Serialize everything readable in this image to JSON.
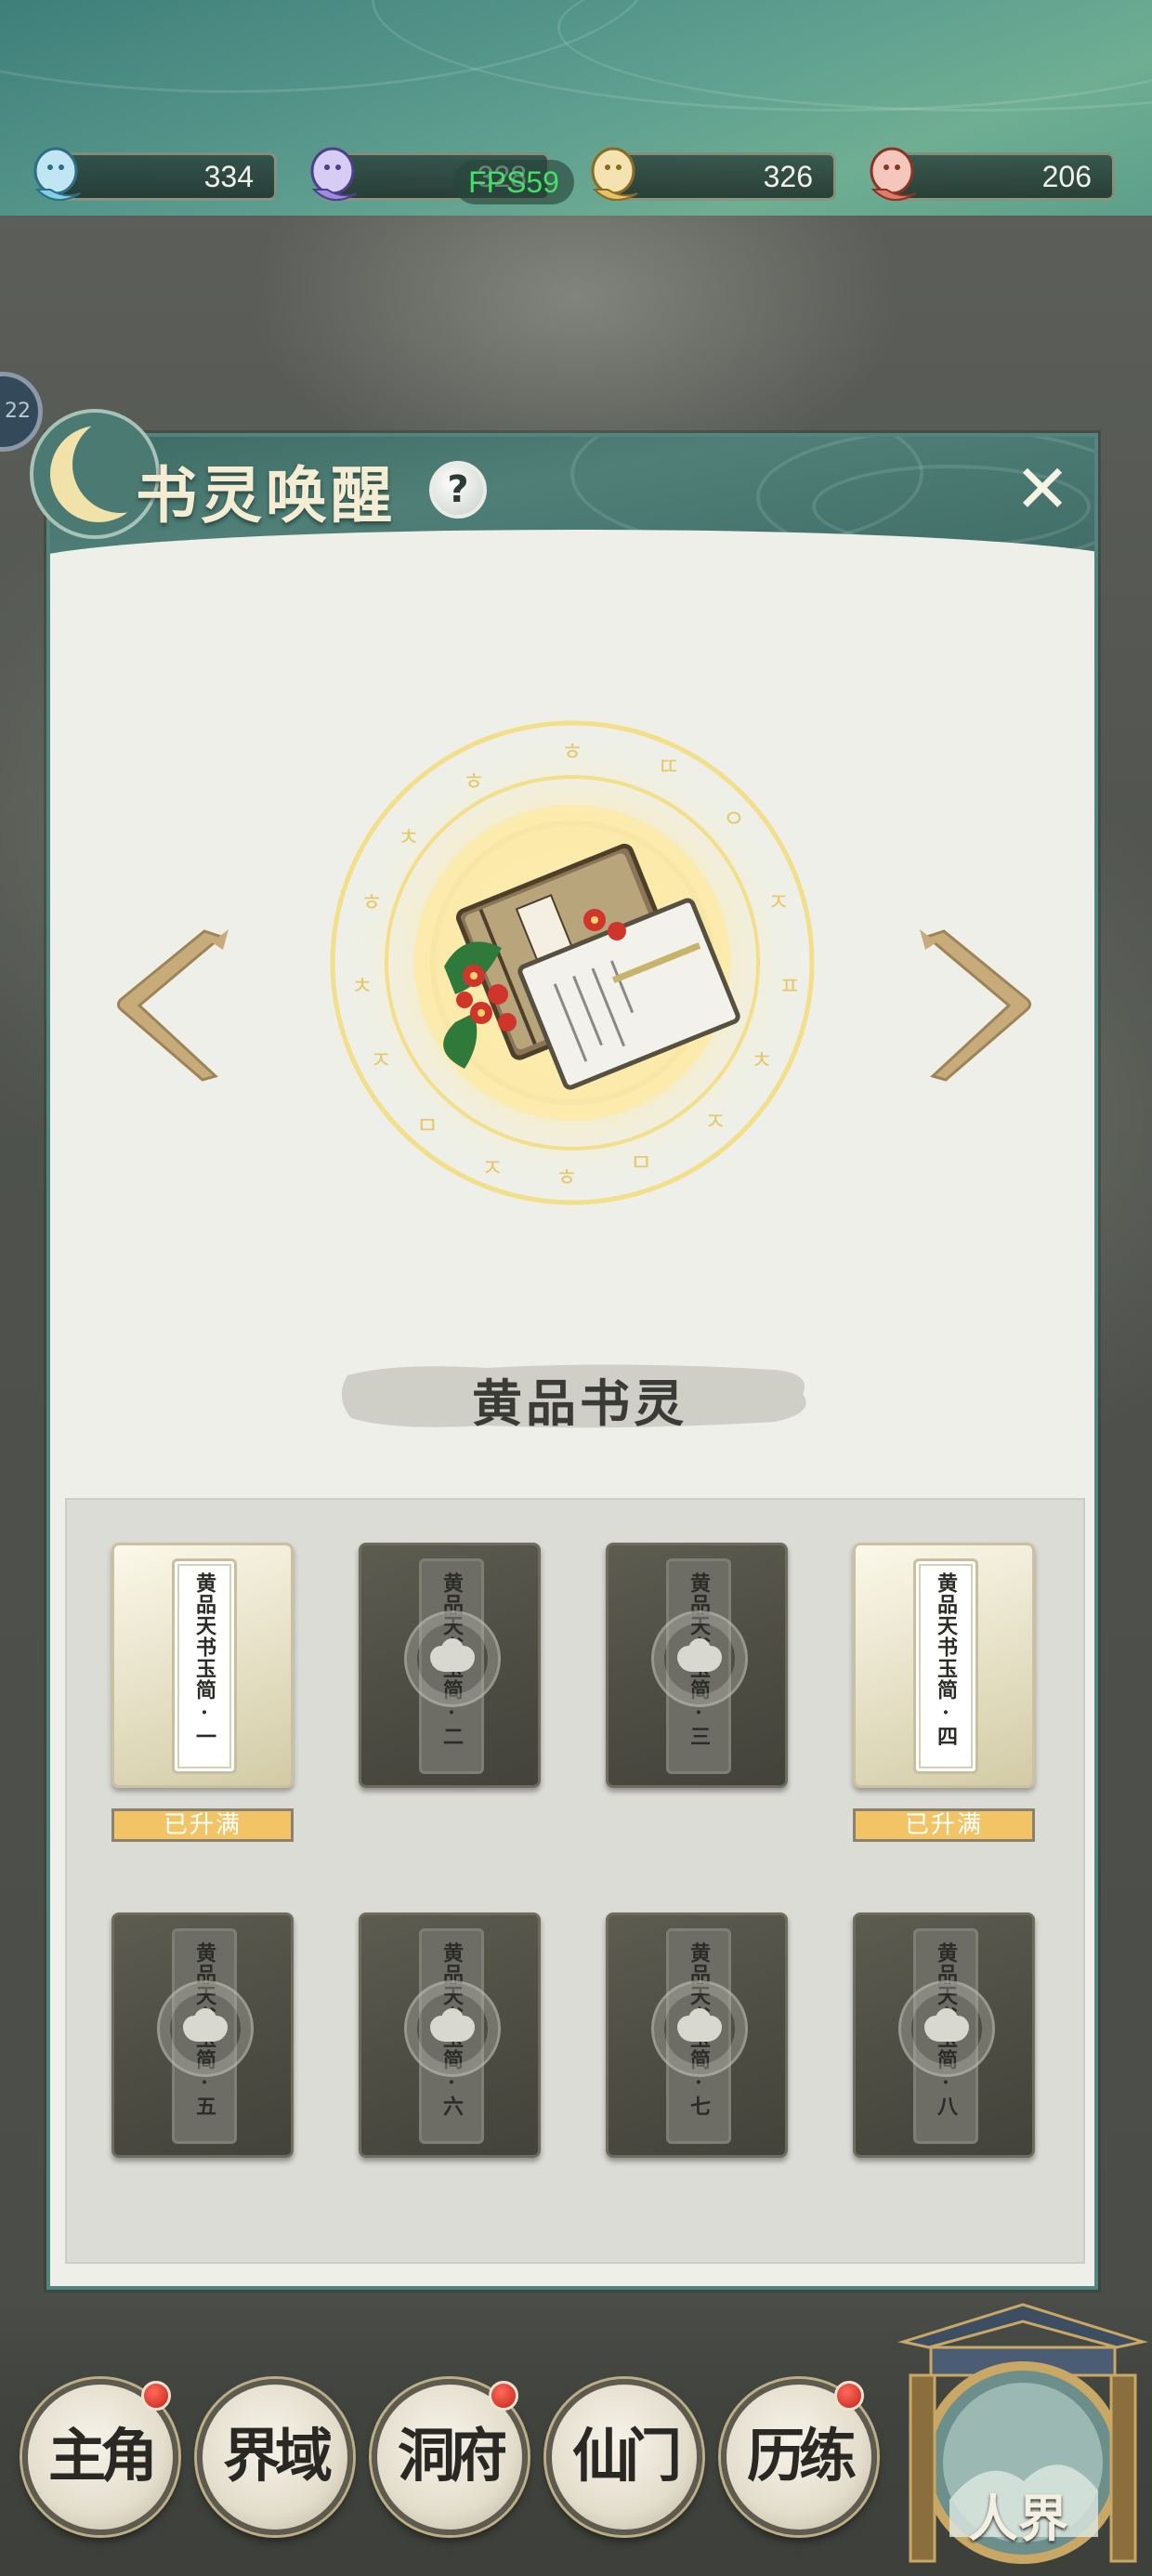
{
  "resources": [
    {
      "name": "resource-1",
      "value": "334",
      "color": "#7fd0e8"
    },
    {
      "name": "resource-2",
      "value": "328",
      "color": "#9b8ce0"
    },
    {
      "name": "resource-3",
      "value": "326",
      "color": "#e6c36a"
    },
    {
      "name": "resource-4",
      "value": "206",
      "color": "#e07a6a"
    }
  ],
  "fps": "FPS59",
  "left_badge": "22",
  "dialog": {
    "title": "书灵唤醒",
    "help": "?",
    "close": "✕",
    "spirit_name": "黄品书灵"
  },
  "cards": [
    {
      "label": "黄品天书玉简·一",
      "unlocked": true,
      "badge": "已升满"
    },
    {
      "label": "黄品天书玉简·二",
      "unlocked": false,
      "badge": ""
    },
    {
      "label": "黄品天书玉简·三",
      "unlocked": false,
      "badge": ""
    },
    {
      "label": "黄品天书玉简·四",
      "unlocked": true,
      "badge": "已升满"
    },
    {
      "label": "黄品天书玉简·五",
      "unlocked": false,
      "badge": ""
    },
    {
      "label": "黄品天书玉简·六",
      "unlocked": false,
      "badge": ""
    },
    {
      "label": "黄品天书玉简·七",
      "unlocked": false,
      "badge": ""
    },
    {
      "label": "黄品天书玉简·八",
      "unlocked": false,
      "badge": ""
    }
  ],
  "nav": [
    {
      "label": "主角",
      "dot": true
    },
    {
      "label": "界域",
      "dot": false
    },
    {
      "label": "洞府",
      "dot": true
    },
    {
      "label": "仙门",
      "dot": false
    },
    {
      "label": "历练",
      "dot": true
    }
  ],
  "realm": {
    "label": "人界"
  },
  "colors": {
    "accent_teal": "#4f7f77",
    "badge_gold": "#f2c466",
    "dialog_bg": "#edefe8"
  }
}
